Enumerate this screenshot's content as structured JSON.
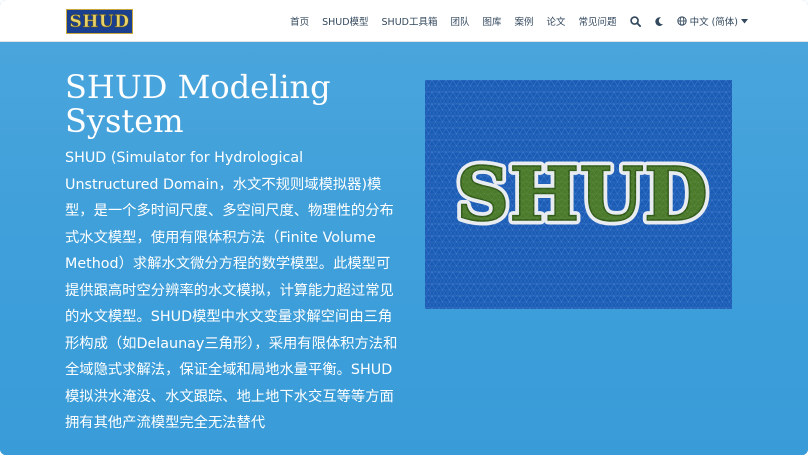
{
  "navbar": {
    "logo_text": "SHUD",
    "items": [
      {
        "label": "首页"
      },
      {
        "label": "SHUD模型"
      },
      {
        "label": "SHUD工具箱"
      },
      {
        "label": "团队"
      },
      {
        "label": "图库"
      },
      {
        "label": "案例"
      },
      {
        "label": "论文"
      },
      {
        "label": "常见问题"
      }
    ],
    "icons": [
      "search-icon",
      "moon-icon",
      "globe-icon",
      "caret-down-icon"
    ],
    "language_label": "中文 (简体)"
  },
  "hero": {
    "title": "SHUD Modeling System",
    "description": "SHUD (Simulator for Hydrological Unstructured Domain，水文不规则域模拟器)模型，是一个多时间尺度、多空间尺度、物理性的分布式水文模型，使用有限体积方法（Finite Volume Method）求解水文微分方程的数学模型。此模型可提供跟高时空分辨率的水文模拟，计算能力超过常见的水文模型。SHUD模型中水文变量求解空间由三角形构成（如Delaunay三角形），采用有限体积方法和全域隐式求解法，保证全域和局地水量平衡。SHUD模拟洪水淹没、水文跟踪、地上地下水交互等等方面拥有其他产流模型完全无法替代",
    "image_text": "SHUD"
  },
  "colors": {
    "hero_bg": "#3e9fda",
    "navbar_bg": "#ffffff",
    "nav_text": "#34495e",
    "logo_bg": "#1a3f8f",
    "logo_text": "#e8d36a",
    "image_water": "#1a5bb5",
    "image_letters": "#4a7a2a"
  }
}
